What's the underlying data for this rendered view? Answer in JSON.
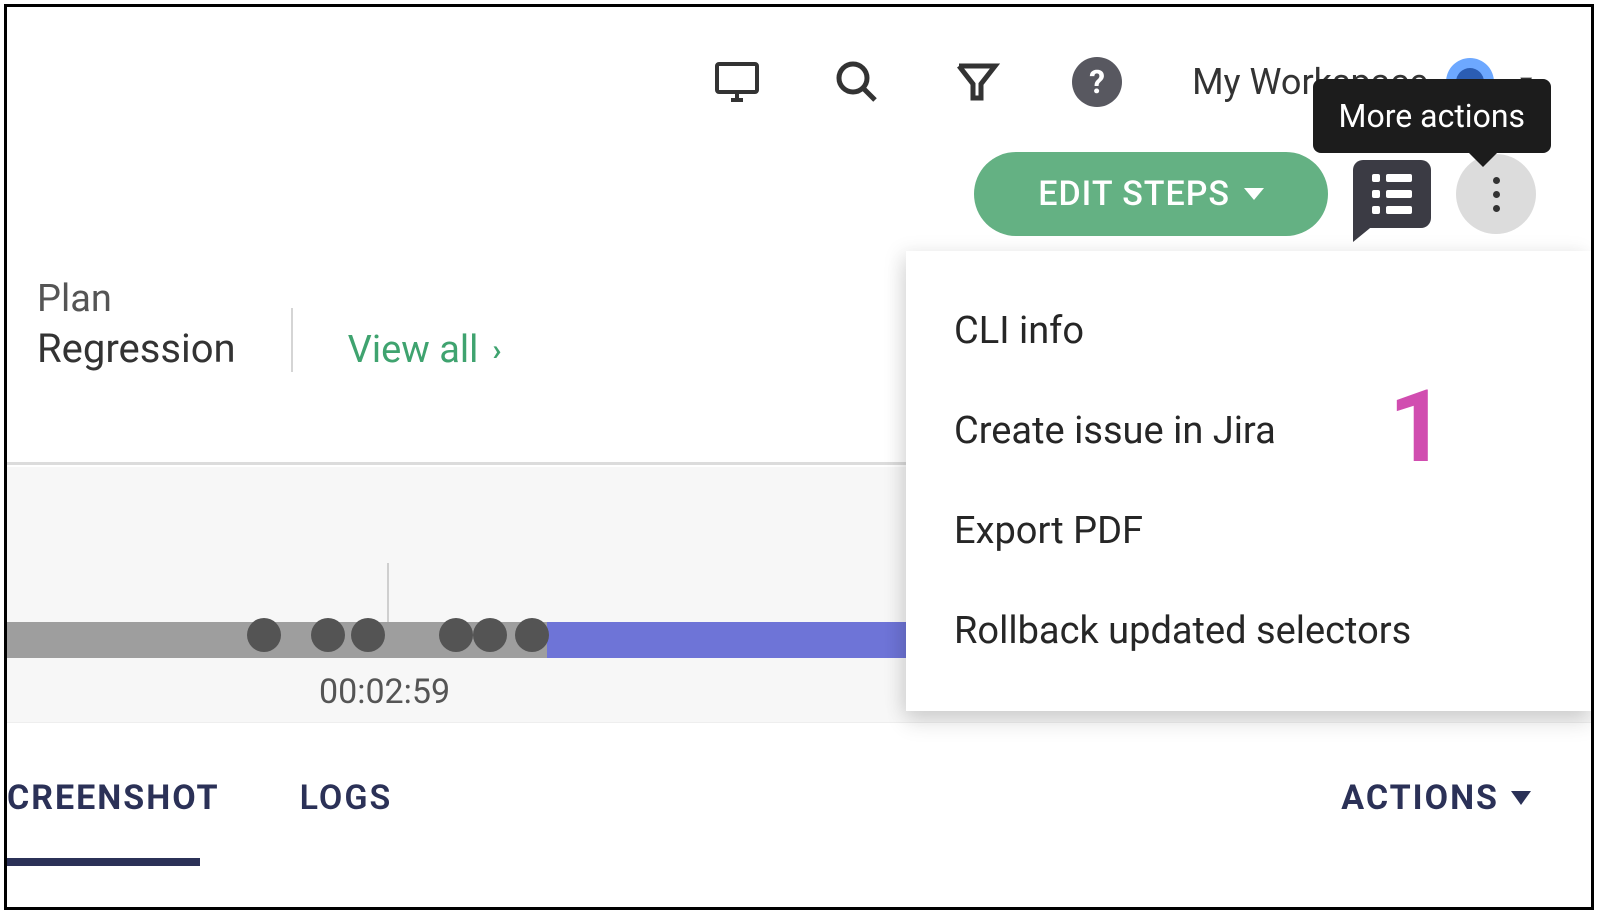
{
  "header": {
    "workspace_label": "My Workspace",
    "tooltip_more_actions": "More actions"
  },
  "toolbar": {
    "edit_steps_label": "EDIT STEPS"
  },
  "plan": {
    "label": "Plan",
    "value": "Regression",
    "view_all": "View all"
  },
  "timeline": {
    "time_label": "00:02:59"
  },
  "tabs": {
    "screenshot": "CREENSHOT",
    "logs": "LOGS",
    "actions": "ACTIONS"
  },
  "more_menu": {
    "items": [
      "CLI info",
      "Create issue in Jira",
      "Export PDF",
      "Rollback updated selectors"
    ]
  },
  "annotation": {
    "one": "1"
  }
}
